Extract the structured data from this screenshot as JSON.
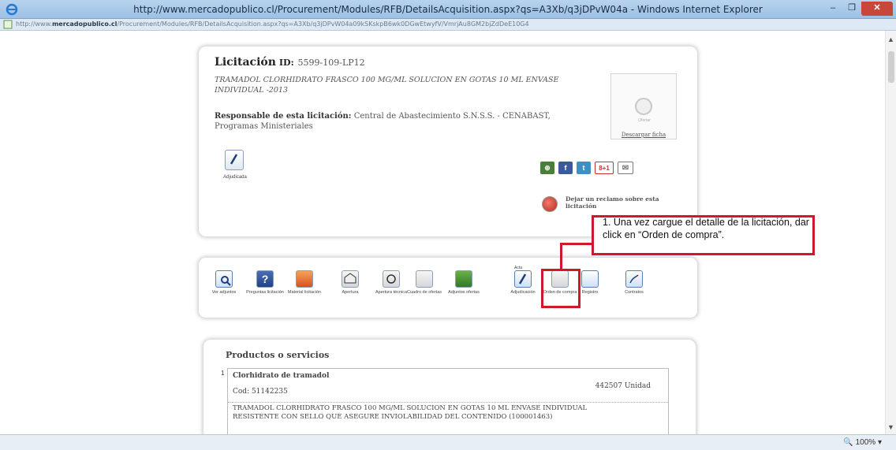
{
  "window": {
    "title": "http://www.mercadopublico.cl/Procurement/Modules/RFB/DetailsAcquisition.aspx?qs=A3Xb/q3jDPvW04a - Windows Internet Explorer",
    "minimize": "–",
    "maximize": "❐",
    "close": "✕"
  },
  "address": {
    "url_prefix": "http://www.",
    "url_domain": "mercadopublico.cl",
    "url_rest": "/Procurement/Modules/RFB/DetailsAcquisition.aspx?qs=A3Xb/q3jDPvW04a09kSKskpB6wk0DGwEtwyfV/VmrjAu8GM2bjZdDeE10G4"
  },
  "licitacion": {
    "heading": "Licitación",
    "id_label": "ID:",
    "id_value": "5599-109-LP12",
    "description": "TRAMADOL CLORHIDRATO FRASCO 100 MG/ML SOLUCION EN GOTAS 10 ML ENVASE INDIVIDUAL -2013",
    "responsable_label": "Responsable de esta licitación:",
    "responsable_value": "Central de Abastecimiento S.N.S.S. - CENABAST, Programas Ministeriales",
    "ficha_placeholder": "Ofertar",
    "descargar_ficha": "Descargar ficha",
    "status_label": "Adjudicada",
    "reclamo": "Dejar un reclamo sobre esta licitación"
  },
  "social": {
    "share": "⊕",
    "facebook": "f",
    "twitter": "t",
    "gplus": "8+1",
    "mail": "✉"
  },
  "annotation": {
    "text": "1. Una vez cargue el detalle de la licitación, dar click en “Orden de compra”."
  },
  "toolbar": {
    "ver_adjuntos": "Ver adjuntos",
    "preguntas": "Preguntas licitación",
    "material": "Material licitación",
    "apertura": "Apertura",
    "apertura_tecnica": "Apertura técnica",
    "cuadro_ofertas": "Cuadro de ofertas",
    "adjuntos_ofertas": "Adjuntos ofertas",
    "acta_tag": "Acta",
    "adjudicacion": "Adjudicación",
    "orden_compra": "Orden de compra",
    "registro": "Registro",
    "contratos": "Contratos"
  },
  "productos": {
    "title": "Productos o servicios",
    "item_number": "1",
    "name": "Clorhidrato de tramadol",
    "code": "Cod: 51142235",
    "quantity": "442507 Unidad",
    "description": "TRAMADOL CLORHIDRATO FRASCO 100 MG/ML SOLUCION EN GOTAS 10 ML ENVASE INDIVIDUAL RESISTENTE CON SELLO QUE ASEGURE INVIOLABILIDAD DEL CONTENIDO (100001463)"
  },
  "status": {
    "zoom": "🔍 100%  ▾"
  },
  "colors": {
    "annotation_red": "#d1182a",
    "titlebar": "#b7d3ee"
  }
}
